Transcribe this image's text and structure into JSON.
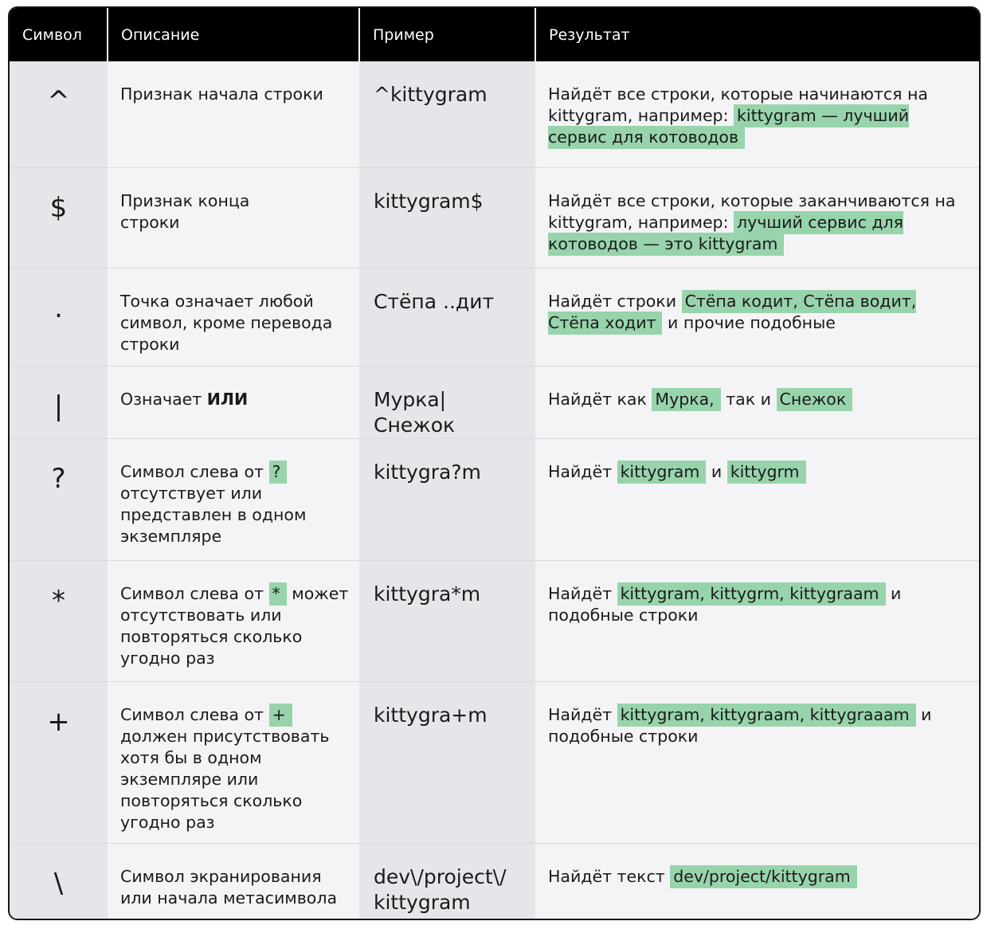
{
  "header": {
    "col1": "Символ",
    "col2": "Описание",
    "col3": "Пример",
    "col4": "Результат"
  },
  "rows": [
    {
      "symbol": "^",
      "desc": [
        "Признак начала строки"
      ],
      "example": "^kittygram",
      "result": {
        "pre": "Найдёт все строки, которые начинаются на kittygram, например:",
        "hl": "kittygram — лучший сервис для котоводов"
      }
    },
    {
      "symbol": "$",
      "desc": [
        "Признак конца",
        "строки"
      ],
      "example": "kittygram$",
      "result": {
        "pre": "Найдёт все строки, которые заканчиваются на kittygram, например:",
        "hl": "лучший сервис для котоводов — это kittygram"
      }
    },
    {
      "symbol": ".",
      "desc": [
        "Точка означает любой",
        "символ, кроме перевода",
        "строки"
      ],
      "example": "Стёпа ..дит",
      "result": {
        "pre": "Найдёт строки",
        "hl": "Стёпа кодит,  Стёпа водит, Стёпа ходит",
        "post": "и прочие подобные"
      }
    },
    {
      "symbol": "|",
      "desc_pre": "Означает",
      "desc_bold": "ИЛИ",
      "example": "Мурка|Снежок",
      "result": {
        "pre": "Найдёт как",
        "hl1": "Мурка,",
        "mid": "так и",
        "hl2": "Снежок"
      }
    },
    {
      "symbol": "?",
      "desc_pre": "Символ слева от",
      "desc_hl": "?",
      "desc_post": [
        "отсутствует или",
        "представлен в одном",
        "экземпляре"
      ],
      "example": "kittygra?m",
      "result": {
        "pre": "Найдёт",
        "hl1": "kittygram",
        "mid": "и",
        "hl2": "kittygrm"
      }
    },
    {
      "symbol": "*",
      "desc_pre": "Символ слева от",
      "desc_hl": "*",
      "desc_after": "может",
      "desc_post": [
        "отсутствовать или",
        "повторяться сколько",
        "угодно раз"
      ],
      "example": "kittygra*m",
      "result": {
        "pre": "Найдёт",
        "hl": "kittygram, kittygrm,  kittygraam",
        "post": "и подобные строки"
      }
    },
    {
      "symbol": "+",
      "desc_pre": "Символ слева от",
      "desc_hl": "+",
      "desc_post": [
        "должен присутствовать",
        "хотя бы в одном",
        "экземпляре или",
        "повторяться сколько",
        "угодно раз"
      ],
      "example": "kittygra+m",
      "result": {
        "pre": "Найдёт",
        "hl": "kittygram, kittygraam,  kittygraaam",
        "post": "и подобные строки"
      }
    },
    {
      "symbol": "\\",
      "desc": [
        "Символ экранирования",
        "или начала метасимвола"
      ],
      "example_lines": [
        "dev\\/project\\/",
        "kittygram"
      ],
      "result": {
        "pre": "Найдёт текст",
        "hl": "dev/project/kittygram"
      }
    }
  ],
  "colors": {
    "header_bg": "#000000",
    "highlight": "#98d4ab",
    "shaded_col": "#e6e6ea",
    "light_col": "#f4f4f6"
  }
}
